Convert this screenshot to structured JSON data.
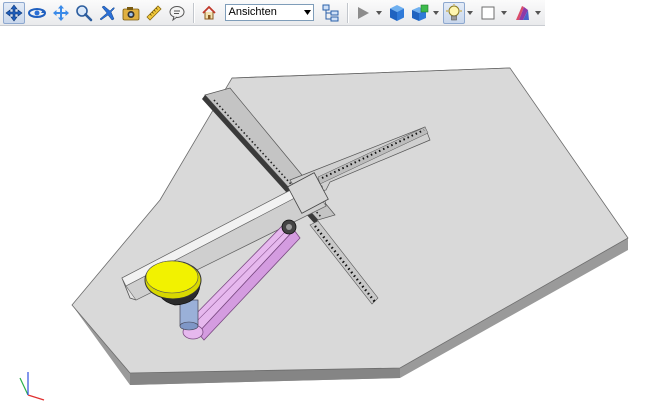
{
  "toolbar": {
    "buttons": [
      {
        "icon": "select-icon",
        "active": true
      },
      {
        "icon": "rotate-view-icon"
      },
      {
        "icon": "pan-icon"
      },
      {
        "icon": "zoom-icon"
      },
      {
        "icon": "fly-icon"
      },
      {
        "icon": "camera-icon"
      },
      {
        "icon": "measure-icon"
      },
      {
        "icon": "comment-icon"
      }
    ],
    "home_icon": "home-icon",
    "views_select_value": "Ansichten",
    "view_tree_icon": "view-tree-icon",
    "play_icon": "play-icon",
    "display_mode_icon": "solid-cube-icon",
    "section_icon": "section-cube-icon",
    "lights_icon": "light-bulb-icon",
    "background_icon": "background-square-icon",
    "appearance_icon": "appearance-icon"
  },
  "colors": {
    "plate_top": "#d6d6d6",
    "plate_edge": "#8f8f8f",
    "knob": "#f2f200",
    "arm": "#e6b8ee",
    "triad_x": "#e03030",
    "triad_y": "#2ab04a",
    "triad_z": "#3050e0"
  }
}
